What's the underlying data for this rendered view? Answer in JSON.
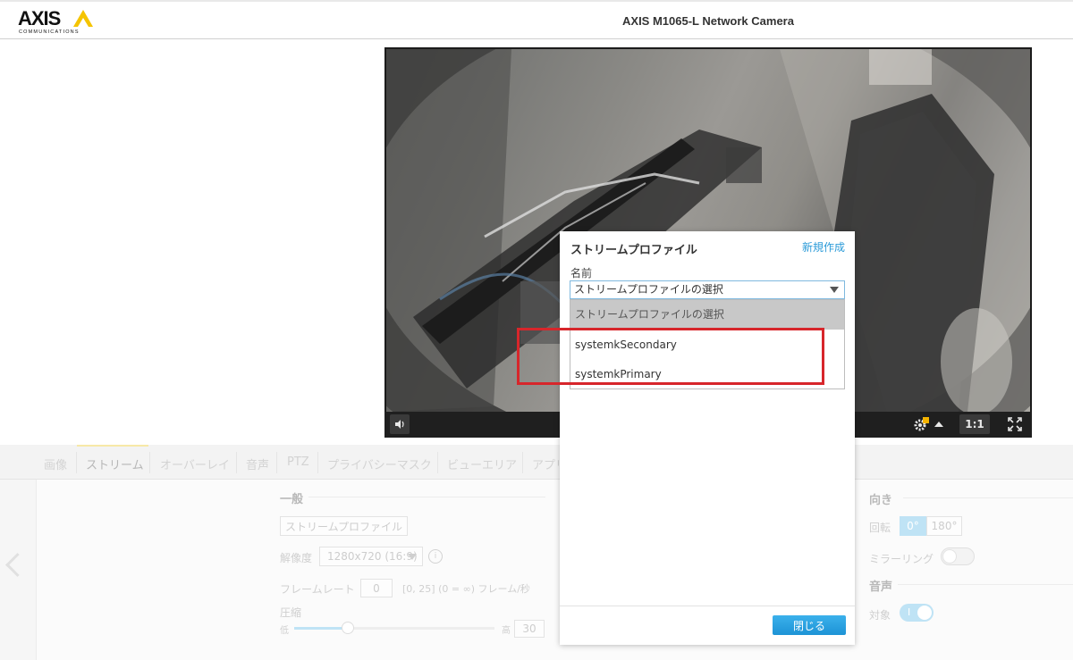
{
  "header": {
    "logo_text": "AXIS",
    "logo_sub": "COMMUNICATIONS",
    "title": "AXIS M1065-L Network Camera"
  },
  "video": {
    "ratio_label": "1:1"
  },
  "tabs": [
    {
      "label": "画像"
    },
    {
      "label": "ストリーム"
    },
    {
      "label": "オーバーレイ"
    },
    {
      "label": "音声"
    },
    {
      "label": "PTZ"
    },
    {
      "label": "プライバシーマスク"
    },
    {
      "label": "ビューエリア"
    },
    {
      "label": "アプリ"
    }
  ],
  "settings": {
    "general_heading": "一般",
    "stream_profile_button": "ストリームプロファイル",
    "resolution_label": "解像度",
    "resolution_value": "1280x720 (16:9)",
    "framerate_label": "フレームレート",
    "framerate_value": "0",
    "framerate_hint": "[0, 25] (0 = ∞) フレーム/秒",
    "compression_label": "圧縮",
    "compression_low": "低",
    "compression_high": "高",
    "compression_value": "30",
    "compression_level": 0.27,
    "orientation_heading": "向き",
    "rotation_label": "回転",
    "rotation_options": [
      "0°",
      "180°"
    ],
    "mirroring_label": "ミラーリング",
    "audio_heading": "音声",
    "audio_target_label": "対象",
    "audio_toggle_label": "I"
  },
  "dialog": {
    "title": "ストリームプロファイル",
    "new_link": "新規作成",
    "name_label": "名前",
    "select_value": "ストリームプロファイルの選択",
    "options": [
      "ストリームプロファイルの選択",
      "systemkSecondary",
      "systemkPrimary"
    ],
    "close_button": "閉じる"
  },
  "colors": {
    "accent_blue": "#1d93d6",
    "highlight_red": "#d7262b",
    "axis_yellow": "#f5c400"
  }
}
